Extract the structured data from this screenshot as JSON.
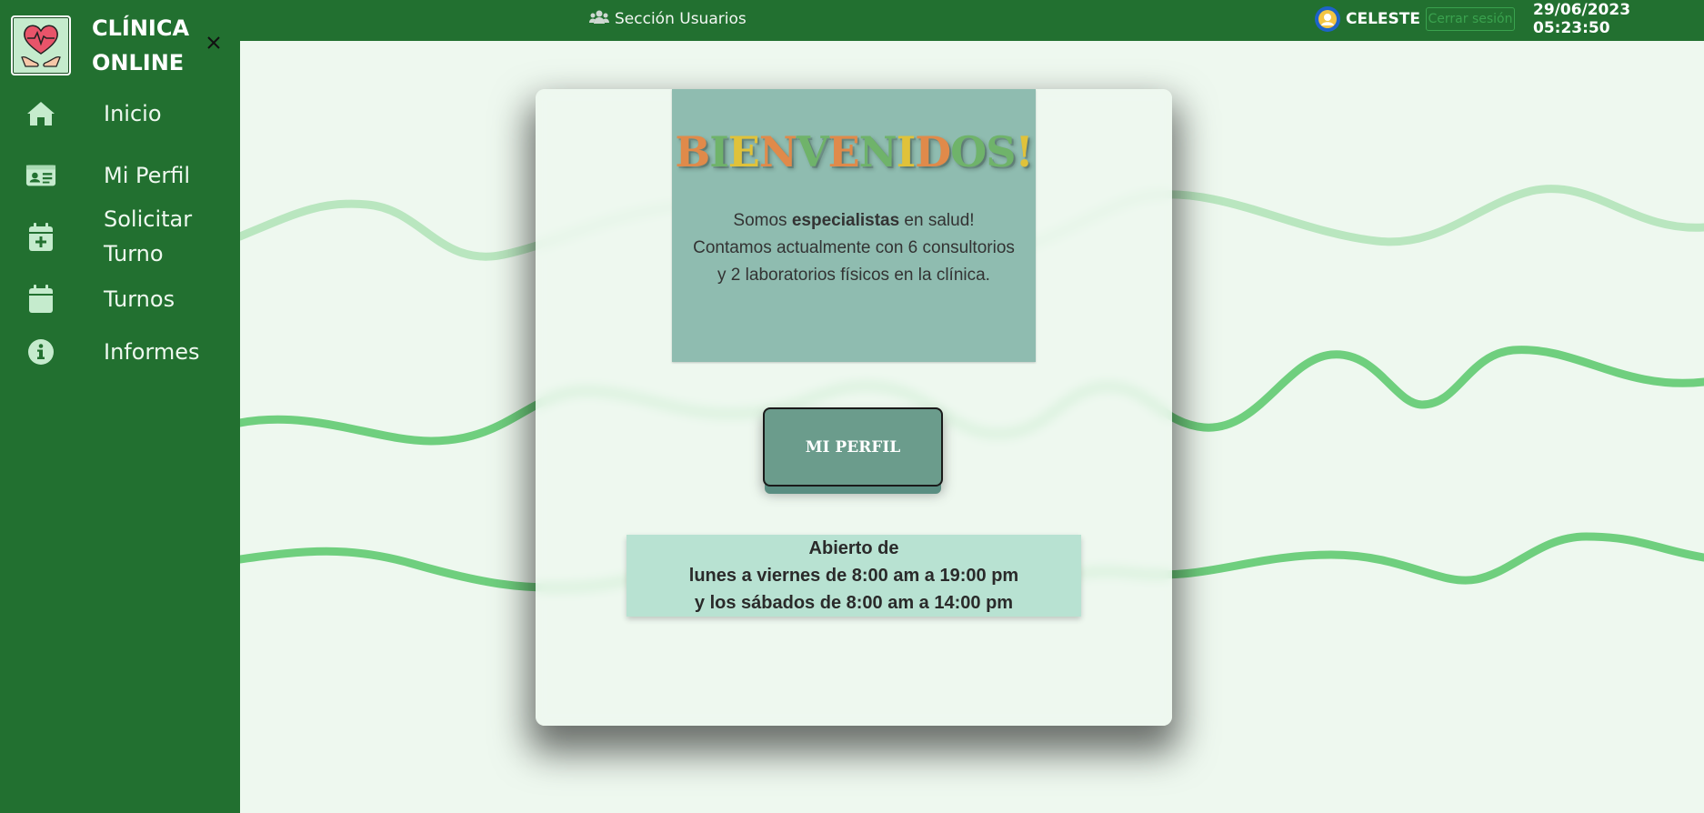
{
  "header": {
    "section_label": "Sección Usuarios",
    "user_name": "CELESTE",
    "logout_label": "Cerrar sesión",
    "datetime": "29/06/2023 05:23:50"
  },
  "sidebar": {
    "brand_line1": "CLÍNICA",
    "brand_line2": "ONLINE",
    "items": [
      {
        "label": "Inicio",
        "icon": "home-icon"
      },
      {
        "label": "Mi Perfil",
        "icon": "id-card-icon"
      },
      {
        "label_line1": "Solicitar",
        "label_line2": "Turno",
        "icon": "calendar-plus-icon"
      },
      {
        "label": "Turnos",
        "icon": "calendar-icon"
      },
      {
        "label": "Informes",
        "icon": "info-icon"
      }
    ]
  },
  "main": {
    "welcome_title_letters": [
      "B",
      "I",
      "E",
      "N",
      "V",
      "E",
      "N",
      "I",
      "D",
      "O",
      "S",
      "!"
    ],
    "welcome_title_colors": [
      "#e08a4a",
      "#6fb36a",
      "#e0c23a",
      "#e08a4a",
      "#6fb36a",
      "#e08a4a",
      "#6fb36a",
      "#e0c23a",
      "#e08a4a",
      "#6fb36a",
      "#6fb36a",
      "#e0c23a"
    ],
    "intro_prefix": "Somos ",
    "intro_bold": "especialistas",
    "intro_suffix": " en salud!",
    "intro_rest": "Contamos actualmente con 6 consultorios y 2 laboratorios físicos en la clínica.",
    "profile_button_label": "MI PERFIL",
    "hours_line1": "Abierto de",
    "hours_line2": "lunes a viernes de 8:00 am a 19:00 pm",
    "hours_line3": "y los sábados de 8:00 am a 14:00 pm"
  },
  "colors": {
    "primary_green": "#227030",
    "page_background": "#eef8ef",
    "wave_light": "#b9e6bf",
    "wave_medium": "#6fcf7e",
    "welcome_panel": "#8fbcb0",
    "hours_panel": "#b8e2d2",
    "button": "#6b9c8c"
  }
}
